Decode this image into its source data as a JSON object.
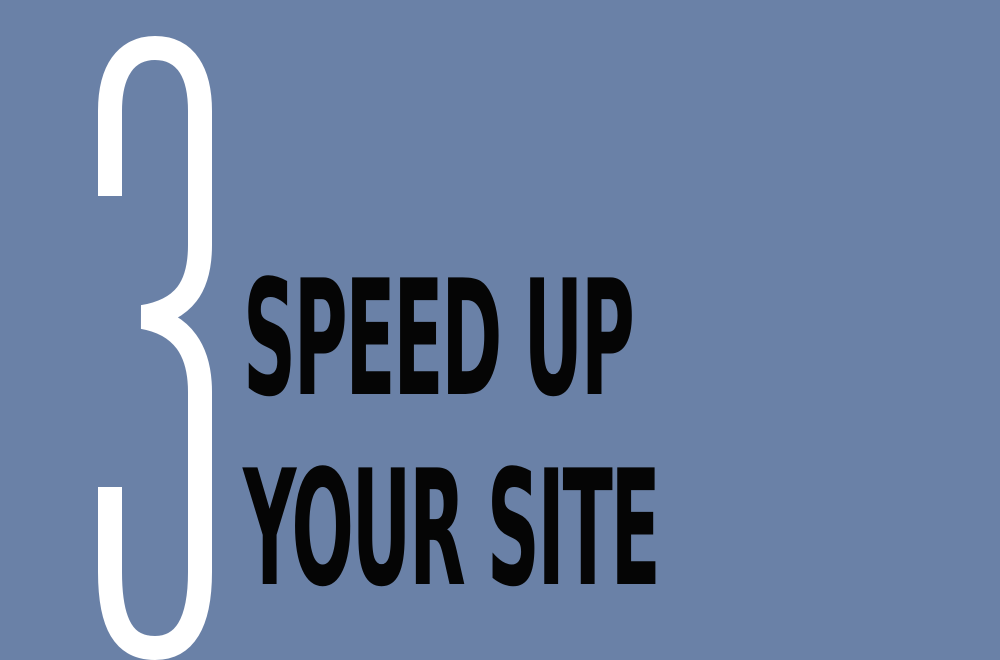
{
  "chapter": {
    "number": "3",
    "title_lines": [
      "SPEED UP",
      "YOUR SITE"
    ]
  },
  "colors": {
    "background": "#6a81a7",
    "number": "#ffffff",
    "title": "#050505"
  }
}
